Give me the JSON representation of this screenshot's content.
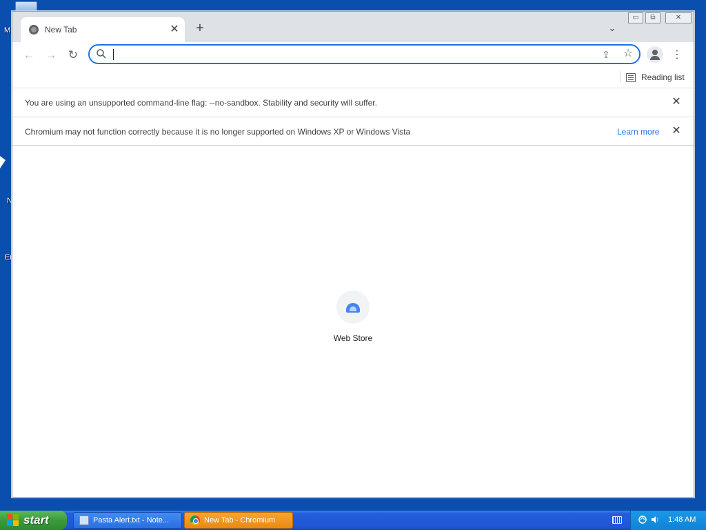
{
  "desktop": {
    "labels": [
      "M",
      "N",
      "Er"
    ]
  },
  "browser": {
    "tab": {
      "title": "New Tab",
      "close_glyph": "✕"
    },
    "new_tab_glyph": "+",
    "tab_search_glyph": "⌄",
    "window_buttons": {
      "minimize": "▭",
      "maximize": "⧉",
      "close": "✕"
    },
    "nav": {
      "back_glyph": "←",
      "forward_glyph": "→",
      "reload_glyph": "↻"
    },
    "omnibox": {
      "value": "",
      "placeholder": ""
    },
    "menu_glyph": "⋮",
    "share_glyph": "⇪",
    "star_glyph": "☆",
    "bookmarks_bar": {
      "reading_list_label": "Reading list"
    },
    "infobars": [
      {
        "text": "You are using an unsupported command-line flag: --no-sandbox. Stability and security will suffer.",
        "close_glyph": "✕"
      },
      {
        "text": "Chromium may not function correctly because it is no longer supported on Windows XP or Windows Vista",
        "link": "Learn more",
        "close_glyph": "✕"
      }
    ],
    "shortcuts": [
      {
        "label": "Web Store",
        "icon": "web-store-icon"
      }
    ]
  },
  "taskbar": {
    "start_label": "start",
    "tasks": [
      {
        "label": "Pasta Alert.txt - Note...",
        "icon": "notepad-icon",
        "active": false
      },
      {
        "label": "New Tab - Chromium",
        "icon": "chromium-icon",
        "active": true
      }
    ],
    "clock": "1:48 AM"
  },
  "colors": {
    "desktop": "#0b4fae",
    "accent": "#1a73e8",
    "taskbar": "#245edb",
    "active_task": "#e98a12"
  }
}
